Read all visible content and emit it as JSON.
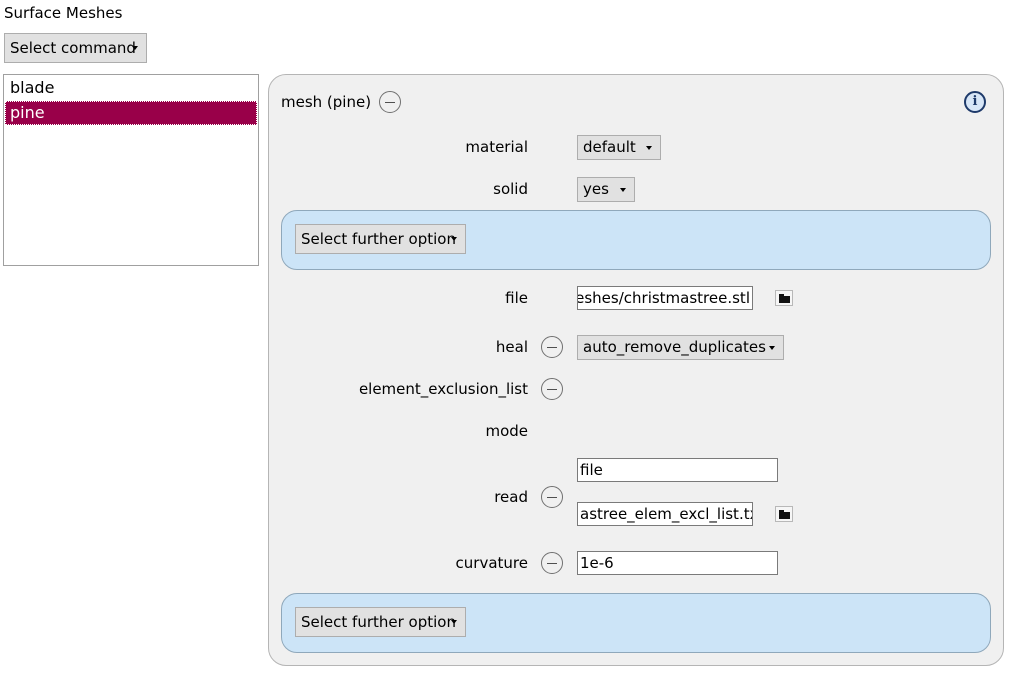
{
  "section_title": "Surface Meshes",
  "command_dropdown": {
    "label": "Select command"
  },
  "mesh_list": {
    "items": [
      "blade",
      "pine"
    ],
    "selected": "pine"
  },
  "panel": {
    "title": "mesh (pine)",
    "material": {
      "label": "material",
      "value": "default"
    },
    "solid": {
      "label": "solid",
      "value": "yes"
    },
    "further_option_1": "Select further option",
    "file": {
      "label": "file",
      "value": "meshes/christmastree.stl"
    },
    "heal": {
      "label": "heal",
      "value": "auto_remove_duplicates"
    },
    "element_exclusion_list": {
      "label": "element_exclusion_list"
    },
    "mode": {
      "label": "mode"
    },
    "read": {
      "label": "read",
      "mode_value": "file",
      "path_value": "astree_elem_excl_list.txt"
    },
    "curvature": {
      "label": "curvature",
      "value": "1e-6"
    },
    "further_option_2": "Select further option"
  },
  "colors": {
    "selection": "#990049",
    "subpanel": "#cce4f7",
    "panel": "#f0f0f0"
  }
}
